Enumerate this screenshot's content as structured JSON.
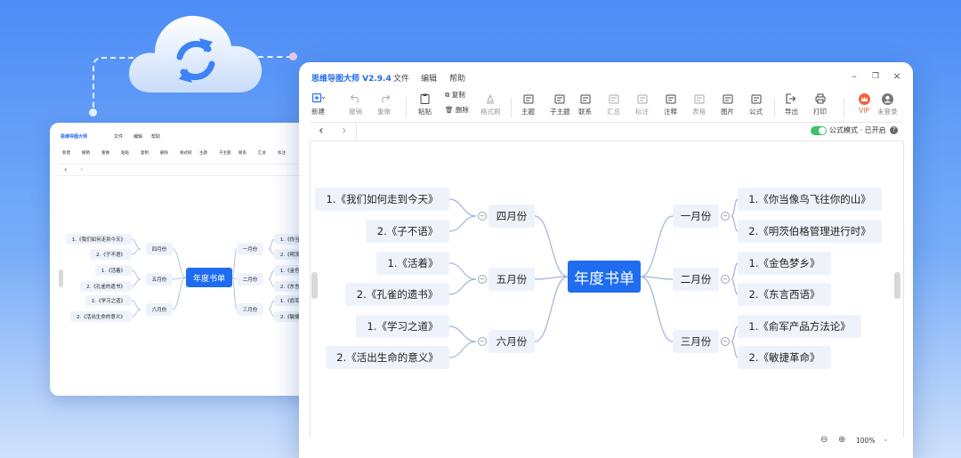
{
  "app": {
    "title": "思维导图大师 V2.9.4",
    "menu": [
      "文件",
      "编辑",
      "帮助"
    ]
  },
  "toolbar": {
    "new": "新建",
    "undo": "撤销",
    "redo": "重做",
    "paste": "粘贴",
    "copy": "复制",
    "delete": "删除",
    "format_painter": "格式刷",
    "topic": "主题",
    "subtopic": "子主题",
    "relation": "联系",
    "summary": "汇总",
    "label": "标注",
    "note": "注释",
    "table": "表格",
    "image": "图片",
    "formula": "公式",
    "export": "导出",
    "print": "打印",
    "vip": "VIP",
    "login": "未登录"
  },
  "formula_mode": {
    "label": "公式模式 · 已开启",
    "enabled": true
  },
  "zoom": "100%",
  "mindmap": {
    "root": "年度书单",
    "left": [
      {
        "month": "四月份",
        "books": [
          "1.《我们如何走到今天》",
          "2.《子不语》"
        ]
      },
      {
        "month": "五月份",
        "books": [
          "1.《活着》",
          "2.《孔雀的遗书》"
        ]
      },
      {
        "month": "六月份",
        "books": [
          "1.《学习之道》",
          "2.《活出生命的意义》"
        ]
      }
    ],
    "right": [
      {
        "month": "一月份",
        "books": [
          "1.《你当像鸟飞往你的山》",
          "2.《明茨伯格管理进行时》"
        ]
      },
      {
        "month": "二月份",
        "books": [
          "1.《金色梦乡》",
          "2.《东言西语》"
        ]
      },
      {
        "month": "三月份",
        "books": [
          "1.《俞军产品方法论》",
          "2.《敏捷革命》"
        ]
      }
    ]
  },
  "back_window": {
    "title": "思维导图大师",
    "menu": [
      "文件",
      "编辑",
      "帮助"
    ],
    "toolbar": [
      "新建",
      "撤销",
      "重做",
      "粘贴",
      "复制",
      "删除",
      "格式刷",
      "主题",
      "子主题",
      "联系",
      "汇总",
      "标注"
    ],
    "root": "年度书单",
    "left": [
      {
        "month": "四月份",
        "books": [
          "1.《我们如何走到今天》",
          "2.《子不语》"
        ]
      },
      {
        "month": "五月份",
        "books": [
          "1.《活着》",
          "2.《孔雀的遗书》"
        ]
      },
      {
        "month": "六月份",
        "books": [
          "1.《学习之道》",
          "2.《活出生命的意义》"
        ]
      }
    ],
    "right": [
      {
        "month": "一月份",
        "books": [
          "1.《你当像",
          "2.《明茨伯"
        ]
      },
      {
        "month": "二月份",
        "books": [
          "1.《金色梦",
          "2.《东言西"
        ]
      },
      {
        "month": "三月份",
        "books": [
          "1.《俞军产",
          "2.《敏捷革"
        ]
      }
    ]
  },
  "colors": {
    "accent": "#1f6cf0",
    "node_bg": "#eef3fb",
    "toggle_on": "#3cc26b",
    "vip": "#f5613a"
  }
}
